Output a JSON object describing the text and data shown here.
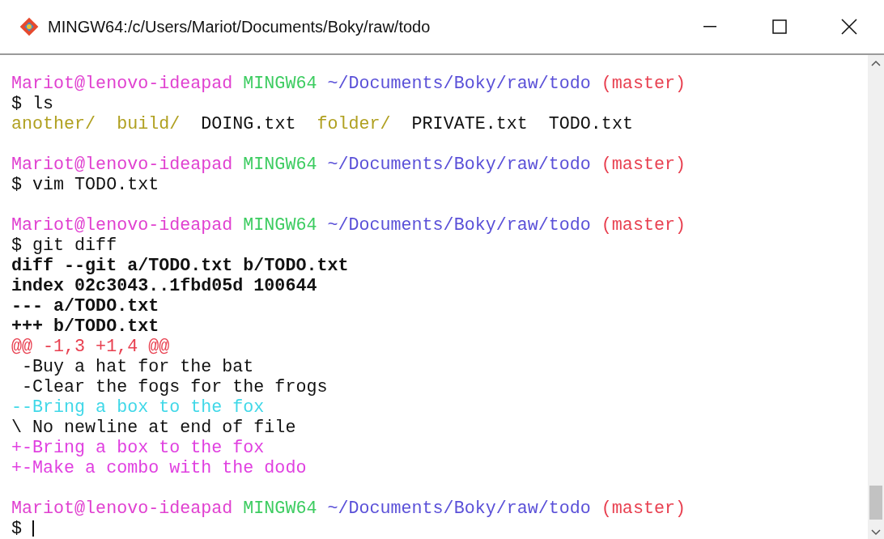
{
  "window": {
    "title": "MINGW64:/c/Users/Mariot/Documents/Boky/raw/todo"
  },
  "terminal": {
    "blocks": [
      {
        "lines": [
          {
            "kind": "prompt",
            "segments": [
              {
                "kind": "user",
                "text": "Mariot@lenovo-ideapad"
              },
              {
                "kind": "host",
                "text": "MINGW64"
              },
              {
                "kind": "path",
                "text": "~/Documents/Boky/raw/todo"
              },
              {
                "kind": "branch",
                "text": "(master)"
              }
            ]
          },
          {
            "kind": "text",
            "segments": [
              {
                "kind": "plain",
                "text": "$ ls"
              }
            ]
          },
          {
            "kind": "listing",
            "segments": [
              {
                "kind": "dir",
                "text": "another/"
              },
              {
                "kind": "dir",
                "text": "build/"
              },
              {
                "kind": "file",
                "text": "DOING.txt"
              },
              {
                "kind": "dir",
                "text": "folder/"
              },
              {
                "kind": "file",
                "text": "PRIVATE.txt"
              },
              {
                "kind": "file",
                "text": "TODO.txt"
              }
            ]
          }
        ]
      },
      {
        "lines": [
          {
            "kind": "prompt",
            "segments": [
              {
                "kind": "user",
                "text": "Mariot@lenovo-ideapad"
              },
              {
                "kind": "host",
                "text": "MINGW64"
              },
              {
                "kind": "path",
                "text": "~/Documents/Boky/raw/todo"
              },
              {
                "kind": "branch",
                "text": "(master)"
              }
            ]
          },
          {
            "kind": "text",
            "segments": [
              {
                "kind": "plain",
                "text": "$ vim TODO.txt"
              }
            ]
          }
        ]
      },
      {
        "lines": [
          {
            "kind": "prompt",
            "segments": [
              {
                "kind": "user",
                "text": "Mariot@lenovo-ideapad"
              },
              {
                "kind": "host",
                "text": "MINGW64"
              },
              {
                "kind": "path",
                "text": "~/Documents/Boky/raw/todo"
              },
              {
                "kind": "branch",
                "text": "(master)"
              }
            ]
          },
          {
            "kind": "text",
            "segments": [
              {
                "kind": "plain",
                "text": "$ git diff"
              }
            ]
          },
          {
            "kind": "text",
            "segments": [
              {
                "kind": "meta",
                "text": "diff --git a/TODO.txt b/TODO.txt"
              }
            ]
          },
          {
            "kind": "text",
            "segments": [
              {
                "kind": "meta",
                "text": "index 02c3043..1fbd05d 100644"
              }
            ]
          },
          {
            "kind": "text",
            "segments": [
              {
                "kind": "meta",
                "text": "--- a/TODO.txt"
              }
            ]
          },
          {
            "kind": "text",
            "segments": [
              {
                "kind": "meta",
                "text": "+++ b/TODO.txt"
              }
            ]
          },
          {
            "kind": "text",
            "segments": [
              {
                "kind": "hunk",
                "text": "@@ -1,3 +1,4 @@"
              }
            ]
          },
          {
            "kind": "text",
            "segments": [
              {
                "kind": "plain",
                "text": " -Buy a hat for the bat"
              }
            ]
          },
          {
            "kind": "text",
            "segments": [
              {
                "kind": "plain",
                "text": " -Clear the fogs for the frogs"
              }
            ]
          },
          {
            "kind": "text",
            "segments": [
              {
                "kind": "removed",
                "text": "--Bring a box to the fox"
              }
            ]
          },
          {
            "kind": "text",
            "segments": [
              {
                "kind": "plain",
                "text": "\\ No newline at end of file"
              }
            ]
          },
          {
            "kind": "text",
            "segments": [
              {
                "kind": "added",
                "text": "+-Bring a box to the fox"
              }
            ]
          },
          {
            "kind": "text",
            "segments": [
              {
                "kind": "added",
                "text": "+-Make a combo with the dodo"
              }
            ]
          }
        ]
      },
      {
        "lines": [
          {
            "kind": "prompt",
            "segments": [
              {
                "kind": "user",
                "text": "Mariot@lenovo-ideapad"
              },
              {
                "kind": "host",
                "text": "MINGW64"
              },
              {
                "kind": "path",
                "text": "~/Documents/Boky/raw/todo"
              },
              {
                "kind": "branch",
                "text": "(master)"
              }
            ]
          },
          {
            "kind": "text",
            "segments": [
              {
                "kind": "plain",
                "text": "$"
              },
              {
                "kind": "cursor"
              }
            ]
          }
        ]
      }
    ]
  }
}
